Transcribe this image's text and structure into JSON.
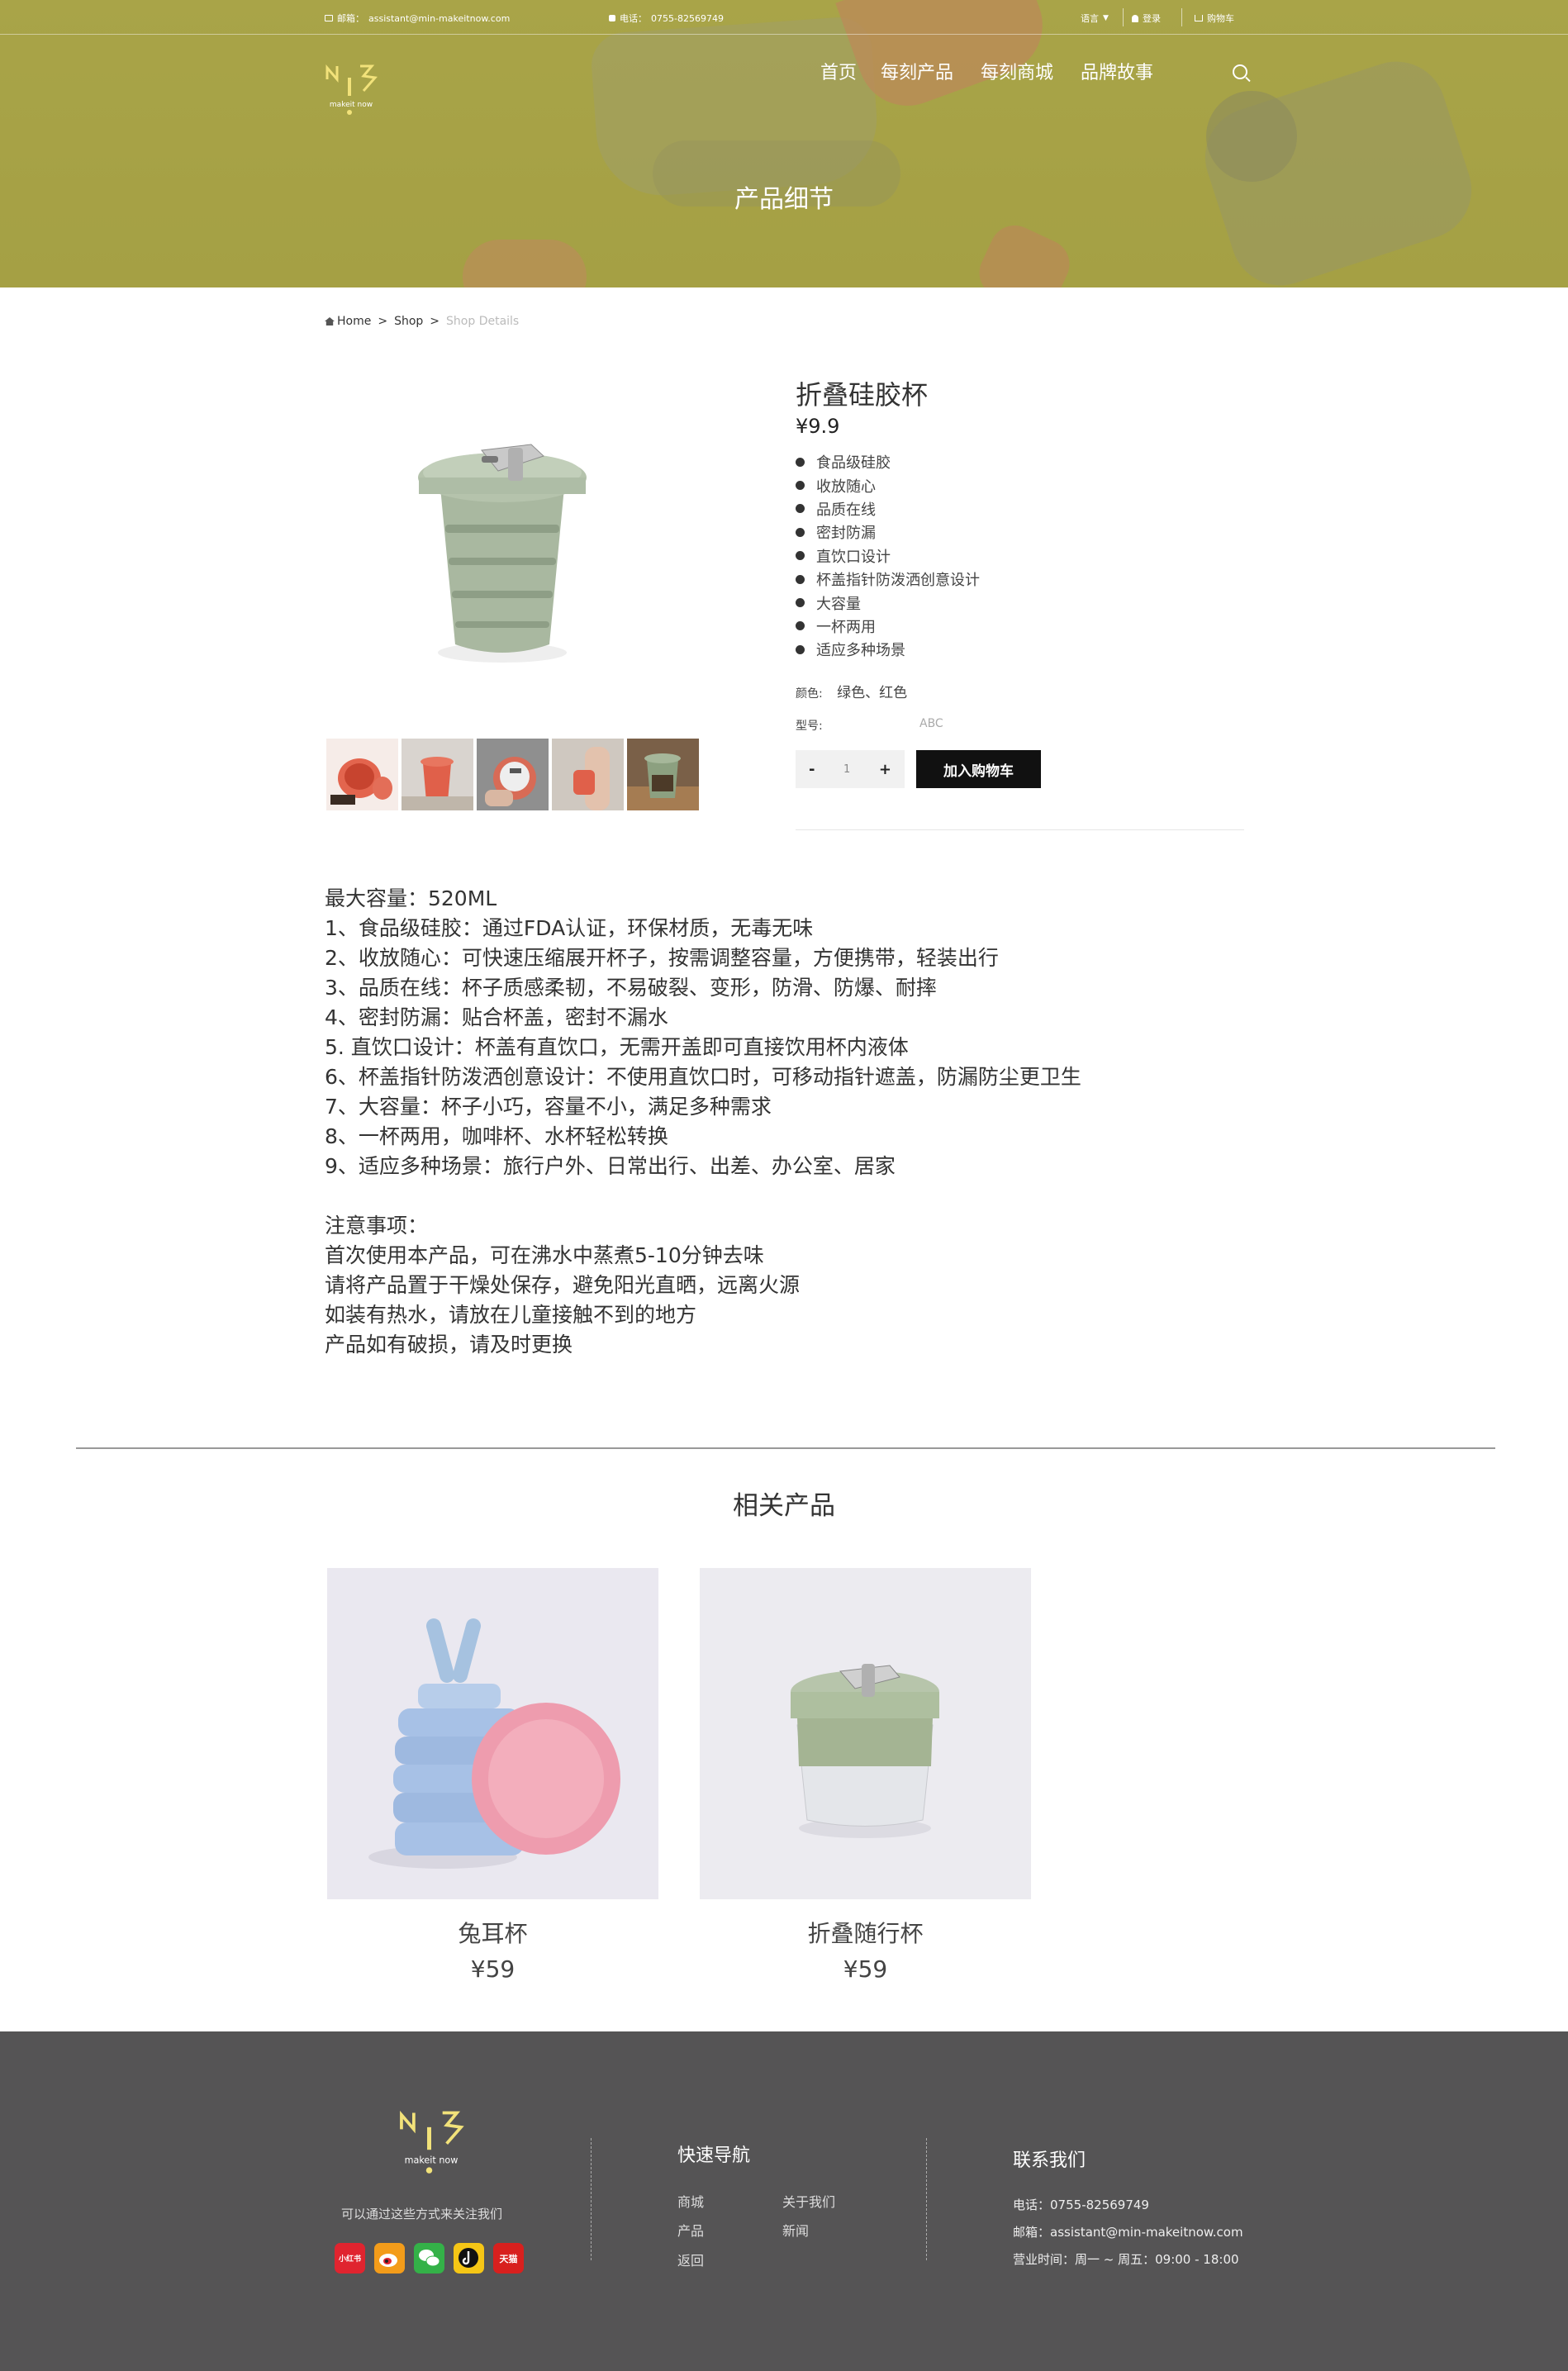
{
  "topbar": {
    "email_label": "邮箱：",
    "email": "assistant@min-makeitnow.com",
    "phone_label": "电话：",
    "phone": "0755-82569749",
    "language": "语言",
    "login": "登录",
    "cart": "购物车"
  },
  "logo": {
    "text": "makeit now"
  },
  "nav": {
    "items": [
      "首页",
      "每刻产品",
      "每刻商城",
      "品牌故事"
    ]
  },
  "hero": {
    "title": "产品细节"
  },
  "breadcrumb": {
    "home": "Home",
    "sep": ">",
    "shop": "Shop",
    "current": "Shop Details"
  },
  "product": {
    "title": "折叠硅胶杯",
    "price": "¥9.9",
    "features": [
      "食品级硅胶",
      "收放随心",
      "品质在线",
      "密封防漏",
      "直饮口设计",
      "杯盖指针防泼洒创意设计",
      "大容量",
      "一杯两用",
      "适应多种场景"
    ],
    "color_label": "颜色:",
    "color_value": "绿色、红色",
    "model_label": "型号:",
    "model_value": "ABC",
    "qty_minus": "-",
    "qty_value": "1",
    "qty_plus": "+",
    "add_to_cart": "加入购物车"
  },
  "description": {
    "lines": [
      "最大容量：520ML",
      "1、食品级硅胶：通过FDA认证，环保材质，无毒无味",
      "2、收放随心：可快速压缩展开杯子，按需调整容量，方便携带，轻装出行",
      "3、品质在线：杯子质感柔韧，不易破裂、变形，防滑、防爆、耐摔",
      "4、密封防漏：贴合杯盖，密封不漏水",
      "5. 直饮口设计：杯盖有直饮口，无需开盖即可直接饮用杯内液体",
      "6、杯盖指针防泼洒创意设计：不使用直饮口时，可移动指针遮盖，防漏防尘更卫生",
      "7、大容量：杯子小巧，容量不小，满足多种需求",
      "8、一杯两用，咖啡杯、水杯轻松转换",
      "9、适应多种场景：旅行户外、日常出行、出差、办公室、居家"
    ],
    "notes": [
      "注意事项：",
      "首次使用本产品，可在沸水中蒸煮5-10分钟去味",
      "请将产品置于干燥处保存，避免阳光直晒，远离火源",
      "如装有热水，请放在儿童接触不到的地方",
      "产品如有破损，请及时更换"
    ]
  },
  "related": {
    "title": "相关产品",
    "items": [
      {
        "name": "兔耳杯",
        "price": "¥59"
      },
      {
        "name": "折叠随行杯",
        "price": "¥59"
      }
    ]
  },
  "footer": {
    "follow_text": "可以通过这些方式来关注我们",
    "socials": [
      "小红书",
      "微博",
      "微信",
      "抖音",
      "天猫"
    ],
    "quicknav_title": "快速导航",
    "links": [
      "商城",
      "关于我们",
      "产品",
      "新闻",
      "返回"
    ],
    "contact_title": "联系我们",
    "phone_label": "电话：",
    "phone": "0755-82569749",
    "email_label": "邮箱：",
    "email": "assistant@min-makeitnow.com",
    "hours_label": "营业时间：",
    "hours": "周一 ~ 周五：09:00 - 18:00"
  },
  "colors": {
    "hero_olive": "#a9a34f",
    "footer_bg": "#555455",
    "button_black": "#111111",
    "logo_yellow": "#f2e27a"
  }
}
